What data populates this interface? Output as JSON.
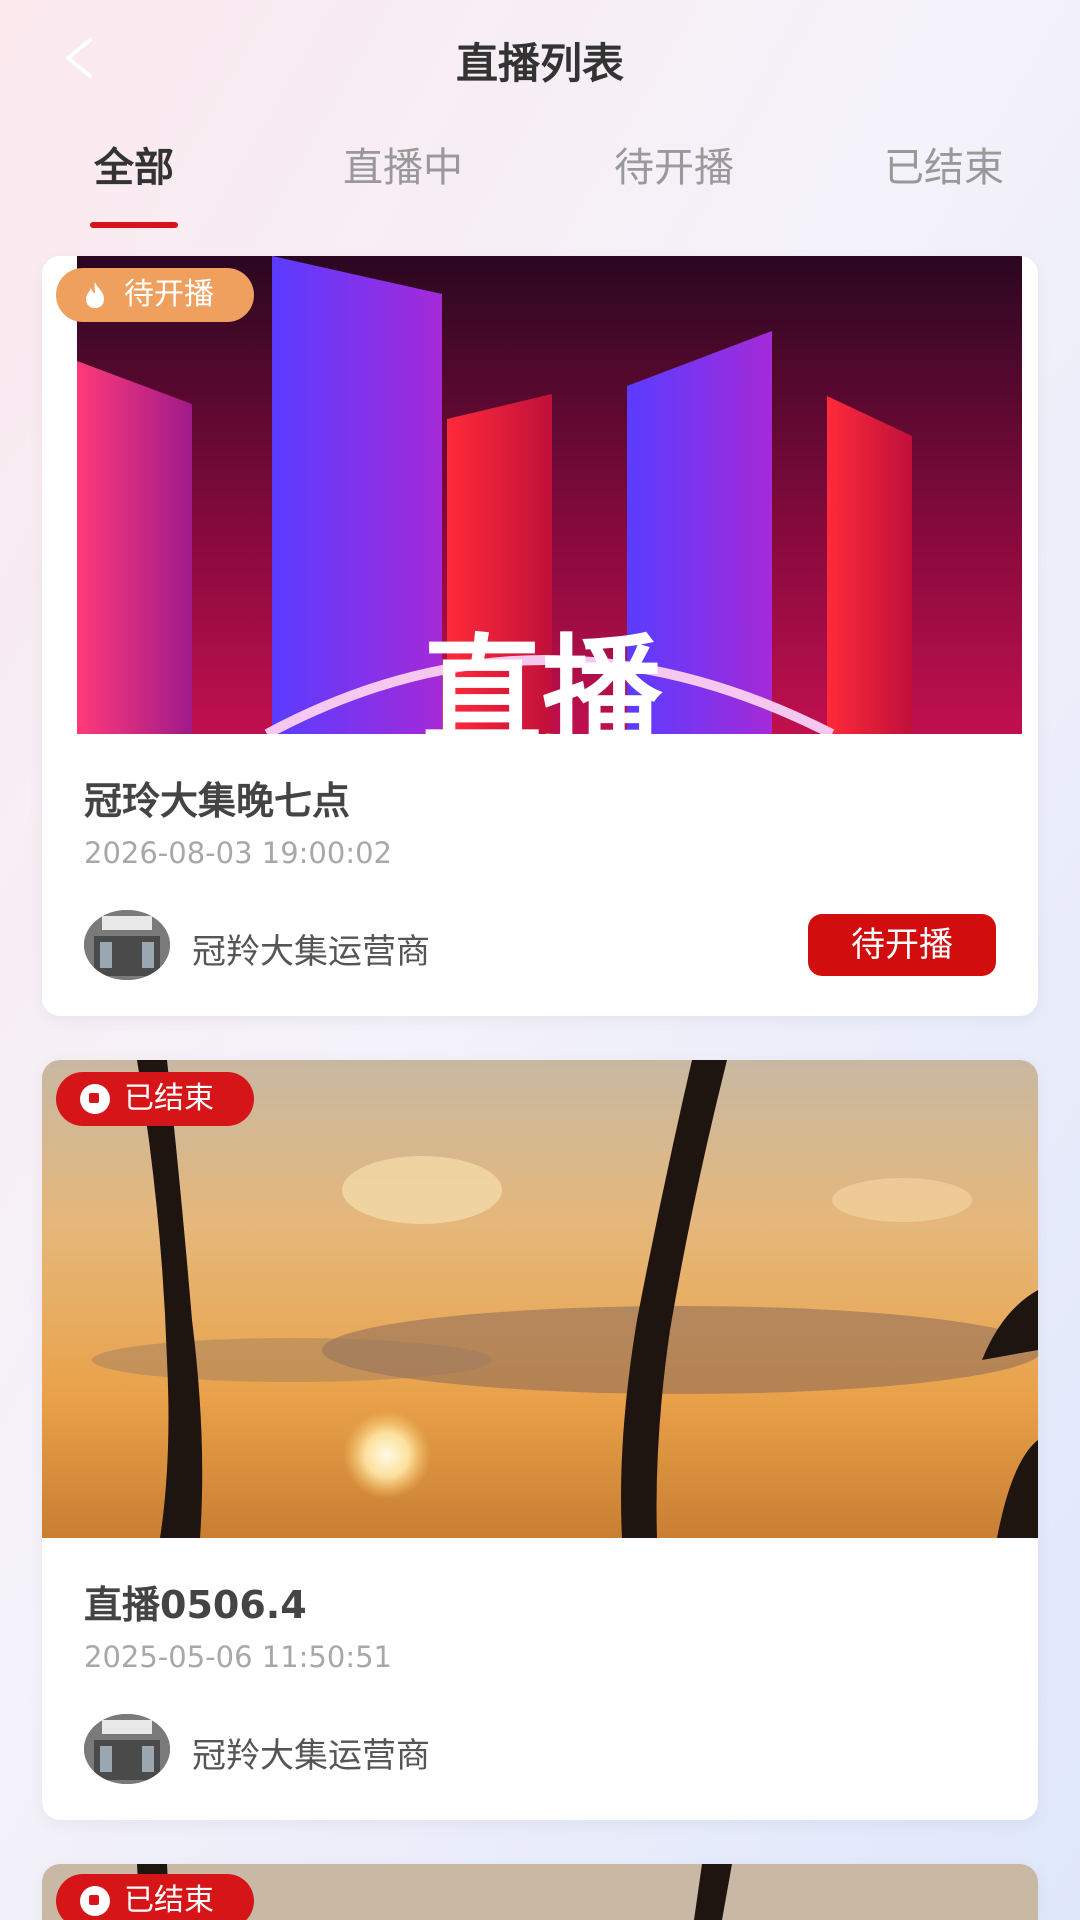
{
  "header": {
    "title": "直播列表",
    "back_icon": "chevron-left-icon"
  },
  "tabs": [
    {
      "label": "全部",
      "active": true
    },
    {
      "label": "直播中",
      "active": false
    },
    {
      "label": "待开播",
      "active": false
    },
    {
      "label": "已结束",
      "active": false
    }
  ],
  "colors": {
    "accent": "#d20d0d",
    "badge_upcoming": "#f0a05e",
    "badge_ended": "#d61518"
  },
  "streams": [
    {
      "badge": "待开播",
      "badge_icon": "flame-icon",
      "cover_text": "直播",
      "title": "冠玲大集晚七点",
      "time": "2026-08-03 19:00:02",
      "host": "冠羚大集运营商",
      "action": "待开播"
    },
    {
      "badge": "已结束",
      "badge_icon": "stop-icon",
      "title": "直播0506.4",
      "time": "2025-05-06 11:50:51",
      "host": "冠羚大集运营商"
    },
    {
      "badge": "已结束",
      "badge_icon": "stop-icon"
    }
  ]
}
